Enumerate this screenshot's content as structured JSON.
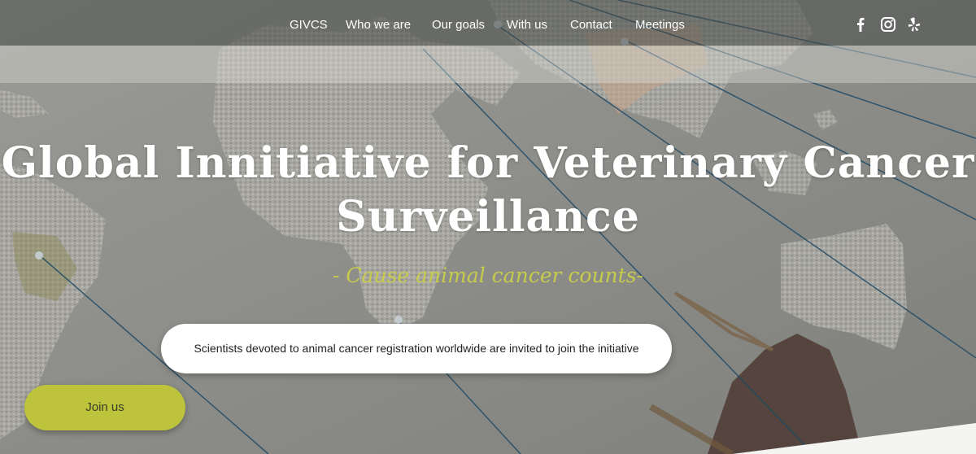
{
  "nav": {
    "links": [
      "GIVCS",
      "Who we are",
      "Our goals",
      "With us",
      "Contact",
      "Meetings"
    ],
    "social": [
      "facebook-icon",
      "instagram-icon",
      "yelp-icon"
    ]
  },
  "hero": {
    "title_line1": "Global Innitiative for Veterinary Cancer",
    "title_line2": "Surveillance",
    "subtitle": "- Cause animal cancer counts-",
    "invite_text": "Scientists devoted to animal cancer registration worldwide are invited to join the initiative",
    "join_label": "Join us"
  },
  "colors": {
    "accent": "#bdc43b",
    "subtitle": "#c7cc4a",
    "string": "#1f4a66"
  }
}
